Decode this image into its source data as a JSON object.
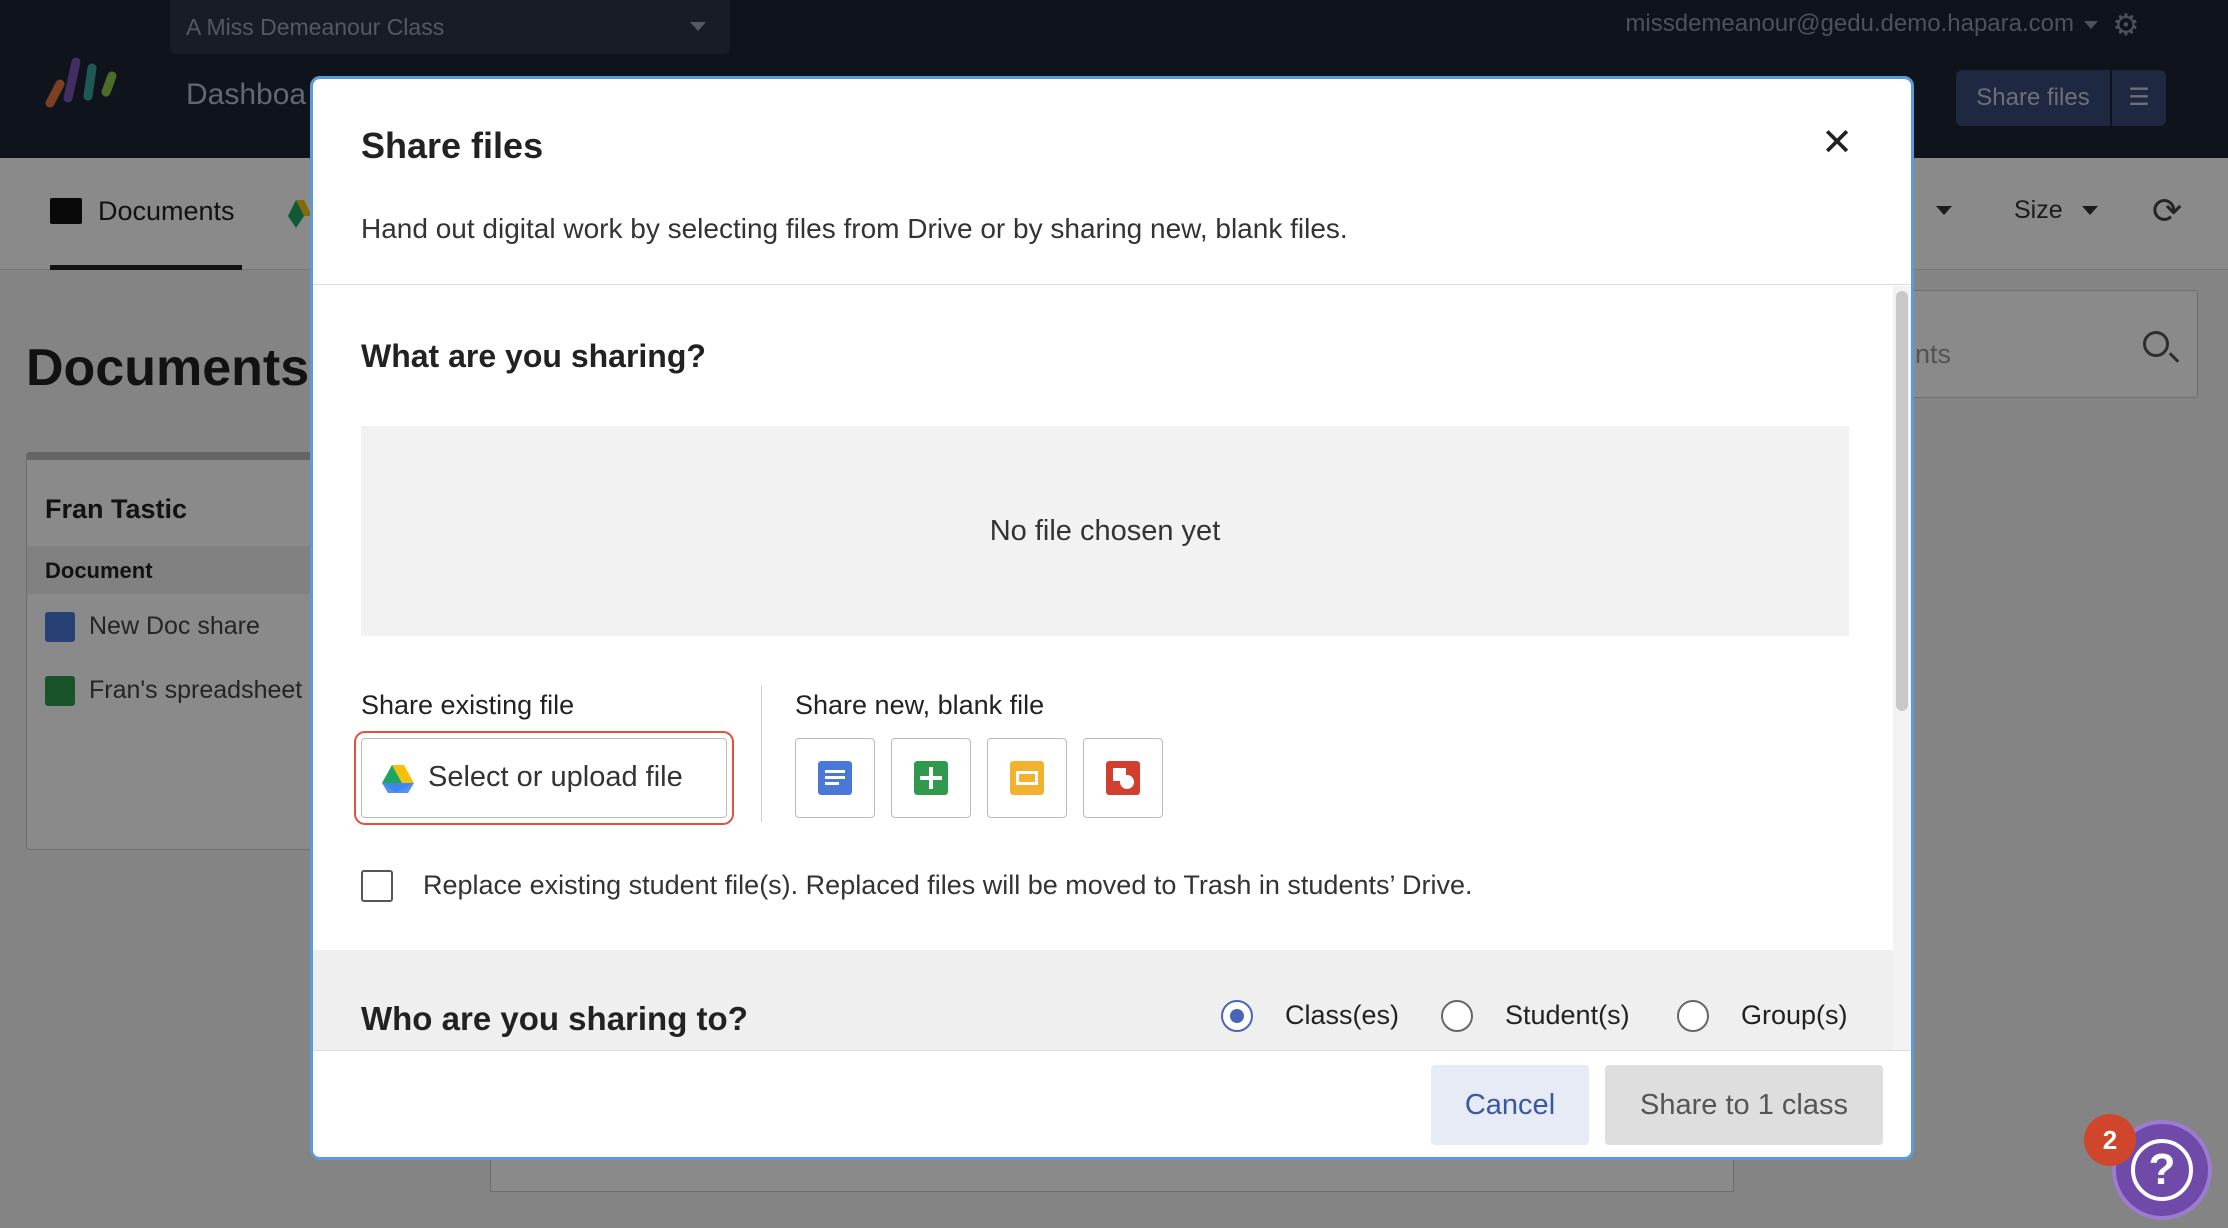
{
  "app": {
    "class_selector": "A Miss Demeanour Class",
    "dashboard_label": "Dashboa",
    "user_email": "missdemeanour@gedu.demo.hapara.com",
    "share_files_label": "Share files",
    "tabs": {
      "documents": "Documents"
    },
    "sort": {
      "size_label": "Size"
    },
    "page_title": "Documents",
    "search_placeholder": "nts",
    "card": {
      "student": "Fran Tastic",
      "column_header": "Document",
      "rows": [
        "New Doc share",
        "Fran's spreadsheet"
      ]
    }
  },
  "modal": {
    "title": "Share files",
    "description": "Hand out digital work by selecting files from Drive or by sharing new, blank files.",
    "what_heading": "What are you sharing?",
    "no_file_text": "No file chosen yet",
    "existing_label": "Share existing file",
    "select_upload_label": "Select or upload file",
    "new_blank_label": "Share new, blank file",
    "blank_types": [
      "docs-icon",
      "sheets-icon",
      "slides-icon",
      "drawings-icon"
    ],
    "replace_label": "Replace existing student file(s). Replaced files will be moved to Trash in students’ Drive.",
    "who_heading": "Who are you sharing to?",
    "recipient_options": [
      "Class(es)",
      "Student(s)",
      "Group(s)"
    ],
    "selected_recipient": "Class(es)",
    "cancel_label": "Cancel",
    "share_label": "Share to 1 class"
  },
  "help": {
    "badge_count": "2"
  },
  "colors": {
    "topbar": "#1c2333",
    "modal_border": "#5b9bd9",
    "highlight": "#e0523a",
    "accent": "#4a64b8",
    "docs": "#4a78d8",
    "sheets": "#2f9a4e",
    "slides": "#f2b230",
    "drawings": "#d13f31"
  }
}
